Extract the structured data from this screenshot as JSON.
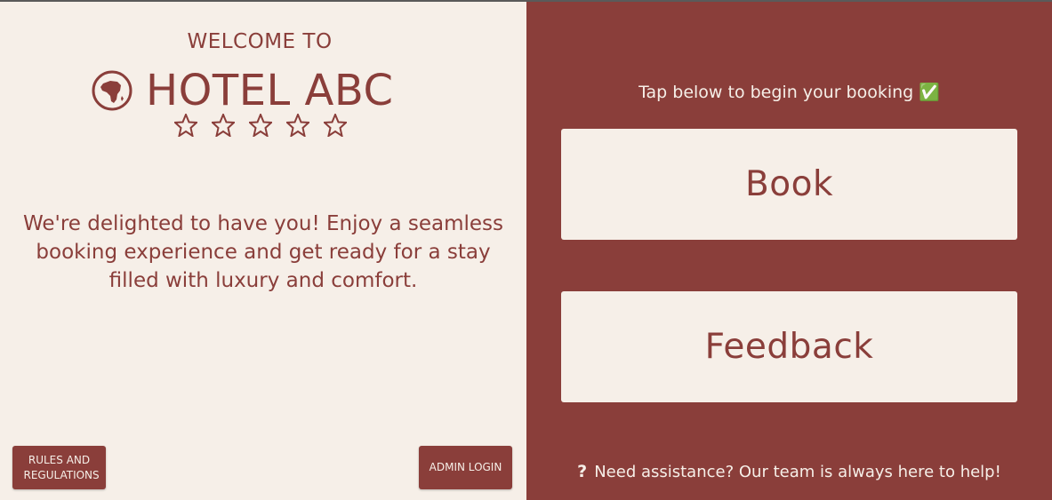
{
  "colors": {
    "brand": "#8a3e3a",
    "cream": "#f6efe8"
  },
  "left": {
    "welcome": "WELCOME TO",
    "hotel_name": "HOTEL ABC",
    "logo_icon": "africa-globe-icon",
    "rating_stars": 5,
    "tagline": "We're delighted to have you! Enjoy a seamless booking experience and get ready for a stay filled with luxury and comfort.",
    "rules_button": "RULES AND REGULATIONS",
    "admin_button": "ADMIN LOGIN"
  },
  "right": {
    "tap_text": "Tap below to begin your booking ✅",
    "book_button": "Book",
    "feedback_button": "Feedback",
    "assist_icon": "?",
    "assist_text": "Need assistance? Our team is always here to help!"
  }
}
